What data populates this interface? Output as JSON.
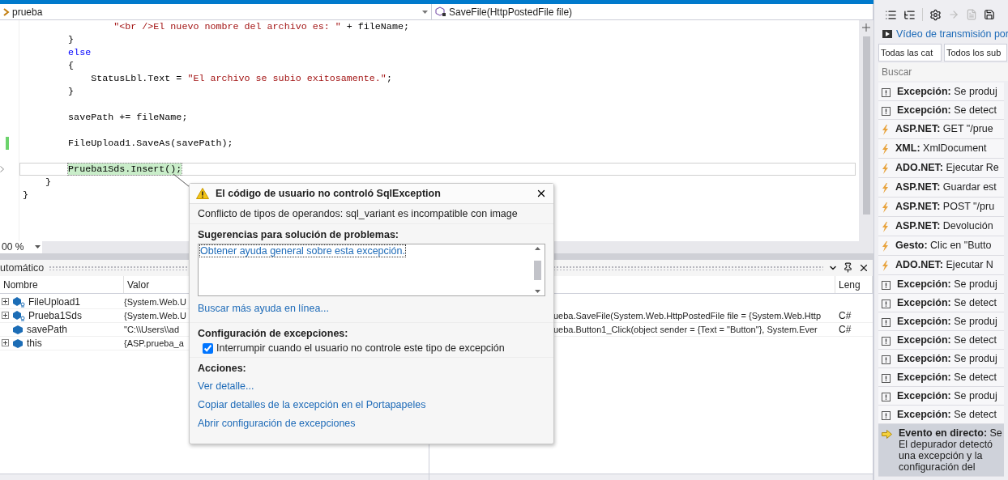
{
  "navigation": {
    "class_selector": "prueba",
    "member_selector": "SaveFile(HttpPostedFile file)"
  },
  "editor": {
    "zoom": "00 %",
    "lines": [
      {
        "kind": "code",
        "changed": false,
        "current": false,
        "tokens": [
          {
            "kind": "string",
            "text": "                \"<br />El nuevo nombre del archivo es: \""
          },
          {
            "kind": "plain",
            "text": " + fileName;"
          }
        ]
      },
      {
        "kind": "code",
        "changed": false,
        "current": false,
        "tokens": [
          {
            "kind": "plain",
            "text": "        }"
          }
        ]
      },
      {
        "kind": "code",
        "changed": false,
        "current": false,
        "tokens": [
          {
            "kind": "keyword",
            "text": "        else"
          }
        ]
      },
      {
        "kind": "code",
        "changed": false,
        "current": false,
        "tokens": [
          {
            "kind": "plain",
            "text": "        {"
          }
        ]
      },
      {
        "kind": "code",
        "changed": false,
        "current": false,
        "tokens": [
          {
            "kind": "plain",
            "text": "            StatusLbl.Text = "
          },
          {
            "kind": "string",
            "text": "\"El archivo se subio exitosamente.\""
          },
          {
            "kind": "plain",
            "text": ";"
          }
        ]
      },
      {
        "kind": "code",
        "changed": false,
        "current": false,
        "tokens": [
          {
            "kind": "plain",
            "text": "        }"
          }
        ]
      },
      {
        "kind": "blank"
      },
      {
        "kind": "code",
        "changed": false,
        "current": false,
        "tokens": [
          {
            "kind": "plain",
            "text": "        savePath += fileName;"
          }
        ]
      },
      {
        "kind": "blank"
      },
      {
        "kind": "code",
        "changed": true,
        "current": false,
        "tokens": [
          {
            "kind": "plain",
            "text": "        FileUpload1.SaveAs(savePath);"
          }
        ]
      },
      {
        "kind": "blank"
      },
      {
        "kind": "code",
        "changed": false,
        "current": true,
        "tokens": [
          {
            "kind": "statement",
            "text": "        Prueba1Sds.Insert();"
          }
        ]
      },
      {
        "kind": "code",
        "changed": false,
        "current": false,
        "tokens": [
          {
            "kind": "plain",
            "text": "    }"
          }
        ]
      },
      {
        "kind": "code",
        "changed": false,
        "current": false,
        "tokens": [
          {
            "kind": "plain",
            "text": "}"
          }
        ]
      }
    ]
  },
  "exception_popup": {
    "title": "El código de usuario no controló SqlException",
    "message": "Conflicto de tipos de operandos: sql_variant es incompatible con image",
    "troubleshooting": {
      "heading": "Sugerencias para solución de problemas:",
      "tips": [
        "Obtener ayuda general sobre esta excepción."
      ]
    },
    "more_help_link": "Buscar más ayuda en línea...",
    "settings": {
      "heading": "Configuración de excepciones:",
      "options": [
        {
          "label": "Interrumpir cuando el usuario no controle este tipo de excepción",
          "checked": true
        }
      ]
    },
    "actions": {
      "heading": "Acciones:",
      "links": [
        "Ver detalle...",
        "Copiar detalles de la excepción en el Portapapeles",
        "Abrir configuración de excepciones"
      ]
    }
  },
  "autos": {
    "title": "utomático",
    "columns": [
      "Nombre",
      "Valor"
    ],
    "rows": [
      {
        "name": "FileUpload1",
        "value": "{System.Web.U",
        "kind": "member",
        "expandable": true
      },
      {
        "name": "Prueba1Sds",
        "value": "{System.Web.U",
        "kind": "member",
        "expandable": true
      },
      {
        "name": "savePath",
        "value": "\"C:\\\\Users\\\\ad",
        "kind": "local",
        "expandable": false
      },
      {
        "name": "this",
        "value": "{ASP.prueba_a",
        "kind": "local",
        "expandable": true
      }
    ]
  },
  "call_stack": {
    "language_header": "Leng",
    "rows": [
      {
        "text": "ueba.SaveFile(System.Web.HttpPostedFile file = {System.Web.Http",
        "language": "C#"
      },
      {
        "text": "ueba.Button1_Click(object sender = {Text = \"Button\"}, System.Ever",
        "language": "C#"
      }
    ]
  },
  "diagnostics": {
    "link": "Vídeo de transmisión por",
    "category_filter": "Todas las cat",
    "subcategory_filter": "Todos los sub",
    "search": {
      "placeholder": "Buscar"
    },
    "events": [
      {
        "kind": "exception",
        "category": "Excepción:",
        "text": "Se produj",
        "selected": false
      },
      {
        "kind": "exception",
        "category": "Excepción:",
        "text": "Se detect",
        "selected": false
      },
      {
        "kind": "event",
        "category": "ASP.NET:",
        "text": "GET \"/prue",
        "selected": false
      },
      {
        "kind": "event",
        "category": "XML:",
        "text": "XmlDocument",
        "selected": false
      },
      {
        "kind": "event",
        "category": "ADO.NET:",
        "text": "Ejecutar Re",
        "selected": false
      },
      {
        "kind": "event",
        "category": "ASP.NET:",
        "text": "Guardar est",
        "selected": false
      },
      {
        "kind": "event",
        "category": "ASP.NET:",
        "text": "POST \"/pru",
        "selected": false
      },
      {
        "kind": "event",
        "category": "ASP.NET:",
        "text": "Devolución",
        "selected": false
      },
      {
        "kind": "event",
        "category": "Gesto:",
        "text": "Clic en \"Butto",
        "selected": false
      },
      {
        "kind": "event",
        "category": "ADO.NET:",
        "text": "Ejecutar N",
        "selected": false
      },
      {
        "kind": "exception",
        "category": "Excepción:",
        "text": "Se produj",
        "selected": false
      },
      {
        "kind": "exception",
        "category": "Excepción:",
        "text": "Se detect",
        "selected": false
      },
      {
        "kind": "exception",
        "category": "Excepción:",
        "text": "Se produj",
        "selected": false
      },
      {
        "kind": "exception",
        "category": "Excepción:",
        "text": "Se detect",
        "selected": false
      },
      {
        "kind": "exception",
        "category": "Excepción:",
        "text": "Se produj",
        "selected": false
      },
      {
        "kind": "exception",
        "category": "Excepción:",
        "text": "Se detect",
        "selected": false
      },
      {
        "kind": "exception",
        "category": "Excepción:",
        "text": "Se produj",
        "selected": false
      },
      {
        "kind": "exception",
        "category": "Excepción:",
        "text": "Se detect",
        "selected": false
      },
      {
        "kind": "live",
        "category": "Evento en directo:",
        "text": "Se",
        "detail": "El depurador detectó una excepción y la configuración del",
        "selected": true
      }
    ]
  }
}
